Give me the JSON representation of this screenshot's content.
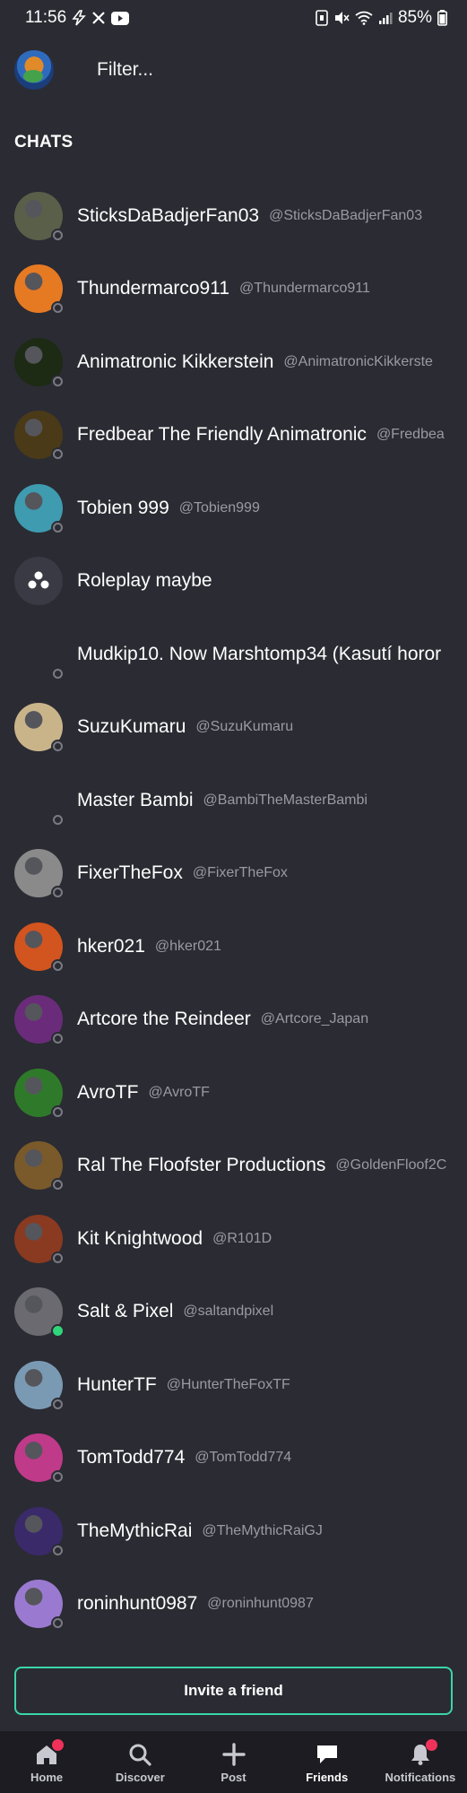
{
  "status_bar": {
    "time": "11:56",
    "battery": "85%",
    "left_icons": [
      "flash-icon",
      "x-logo-icon",
      "youtube-icon"
    ],
    "right_icons": [
      "nfc-icon",
      "mute-icon",
      "wifi-icon",
      "signal-icon",
      "battery-icon"
    ]
  },
  "header": {
    "filter_placeholder": "Filter..."
  },
  "section_title": "CHATS",
  "chats": [
    {
      "name": "SticksDaBadjerFan03",
      "handle": "@SticksDaBadjerFan03",
      "online": false,
      "avatar_color": "#5a5f4a"
    },
    {
      "name": "Thundermarco911",
      "handle": "@Thundermarco911",
      "online": false,
      "avatar_color": "#e67a22"
    },
    {
      "name": "Animatronic Kikkerstein",
      "handle": "@AnimatronicKikkerste",
      "online": false,
      "avatar_color": "#1d2a14"
    },
    {
      "name": "Fredbear The Friendly Animatronic",
      "handle": "@Fredbea",
      "online": false,
      "avatar_color": "#4a3a18"
    },
    {
      "name": "Tobien 999",
      "handle": "@Tobien999",
      "online": false,
      "avatar_color": "#3e9bb0"
    },
    {
      "name": "Roleplay   maybe",
      "handle": "",
      "online": null,
      "avatar_color": "#3a3a44"
    },
    {
      "name": "Mudkip10.  Now Marshtomp34 (Kasutí horor",
      "handle": "",
      "online": false,
      "avatar_color": ""
    },
    {
      "name": "SuzuKumaru",
      "handle": "@SuzuKumaru",
      "online": false,
      "avatar_color": "#c9b48a"
    },
    {
      "name": "Master Bambi",
      "handle": "@BambiTheMasterBambi",
      "online": false,
      "avatar_color": ""
    },
    {
      "name": "FixerTheFox",
      "handle": "@FixerTheFox",
      "online": false,
      "avatar_color": "#8a8a8a"
    },
    {
      "name": "hker021",
      "handle": "@hker021",
      "online": false,
      "avatar_color": "#d2541e"
    },
    {
      "name": "Artcore the Reindeer",
      "handle": "@Artcore_Japan",
      "online": false,
      "avatar_color": "#6a2c7a"
    },
    {
      "name": "AvroTF",
      "handle": "@AvroTF",
      "online": false,
      "avatar_color": "#2f7a2a"
    },
    {
      "name": "Ral The Floofster Productions",
      "handle": "@GoldenFloof2C",
      "online": false,
      "avatar_color": "#7a5a2a"
    },
    {
      "name": "Kit Knightwood",
      "handle": "@R101D",
      "online": false,
      "avatar_color": "#8a3a20"
    },
    {
      "name": "Salt & Pixel",
      "handle": "@saltandpixel",
      "online": true,
      "avatar_color": "#6a6a70"
    },
    {
      "name": "HunterTF",
      "handle": "@HunterTheFoxTF",
      "online": false,
      "avatar_color": "#7a9ab4"
    },
    {
      "name": "TomTodd774",
      "handle": "@TomTodd774",
      "online": false,
      "avatar_color": "#c03a8a"
    },
    {
      "name": "TheMythicRai",
      "handle": "@TheMythicRaiGJ",
      "online": false,
      "avatar_color": "#3a2a6a"
    },
    {
      "name": "roninhunt0987",
      "handle": "@roninhunt0987",
      "online": false,
      "avatar_color": "#9a7ad0"
    }
  ],
  "invite_label": "Invite a friend",
  "nav": {
    "home": "Home",
    "discover": "Discover",
    "post": "Post",
    "friends": "Friends",
    "notifications": "Notifications"
  },
  "colors": {
    "background": "#2b2b33",
    "accent": "#3ad6a8",
    "badge": "#f0325a",
    "online": "#2fd67a"
  }
}
